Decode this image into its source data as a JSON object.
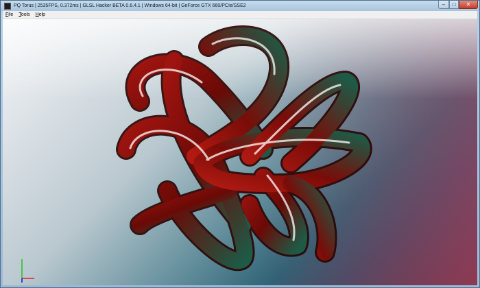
{
  "window": {
    "title": "PQ Torus | 2535FPS, 0.372ms | GLSL Hacker BETA 0.6.4.1 | Windows 64-bit | GeForce GTX 660/PCIe/SSE2",
    "controls": {
      "minimize": "–",
      "maximize": "□",
      "close": "✕"
    }
  },
  "menu": [
    {
      "label": "File",
      "underline": "F"
    },
    {
      "label": "Tools",
      "underline": "T"
    },
    {
      "label": "Help",
      "underline": "H"
    }
  ],
  "viewport": {
    "object": "pq-torus-knot",
    "colors": {
      "tube_red": "#8c0c08",
      "tube_green": "#1e5a46",
      "highlight": "#ffffff"
    },
    "axes": {
      "x_color": "#e02020",
      "y_color": "#20c020",
      "z_color": "#2040e0"
    }
  }
}
